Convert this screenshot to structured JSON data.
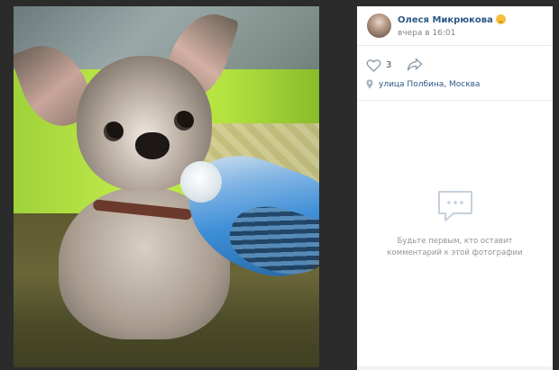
{
  "post": {
    "author": {
      "name": "Олеся Микрюкова",
      "timestamp": "вчера в 16:01",
      "avatar_icon": "avatar-photo",
      "emoji_icon": "smiling-face-emoji"
    },
    "actions": {
      "like_icon": "heart-outline-icon",
      "like_count": "3",
      "share_icon": "share-arrow-icon"
    },
    "location": {
      "icon": "map-pin-icon",
      "text": "улица Полбина, Москва"
    }
  },
  "comments": {
    "empty_icon": "chat-bubble-icon",
    "empty_text": "Будьте первым, кто оставит комментарий к этой фотографии"
  },
  "colors": {
    "link": "#2a5885",
    "muted": "#828282",
    "empty_text": "#939393",
    "background": "#2b2b2b",
    "panel": "#ffffff"
  }
}
